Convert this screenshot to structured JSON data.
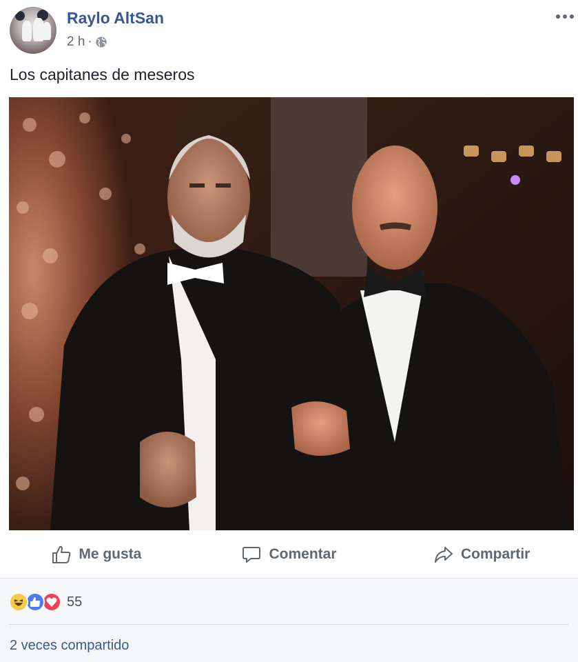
{
  "post": {
    "author": "Raylo AltSan",
    "time": "2 h",
    "separator": "·",
    "privacy_icon": "globe-icon",
    "more_icon": "more-options-icon",
    "text": "Los capitanes de meseros"
  },
  "actions": [
    {
      "label": "Me gusta",
      "icon": "thumbs-up-icon"
    },
    {
      "label": "Comentar",
      "icon": "comment-icon"
    },
    {
      "label": "Compartir",
      "icon": "share-icon"
    }
  ],
  "footer": {
    "reactions": [
      "haha-reaction-icon",
      "like-reaction-icon",
      "love-reaction-icon"
    ],
    "reaction_count": "55",
    "shares": "2 veces compartido"
  },
  "colors": {
    "author_link": "#365899",
    "action_text": "#606770",
    "footer_bg": "#f6f7f9",
    "like_blue": "#4b7bf0",
    "love_red": "#f0405a",
    "haha_yellow": "#f7c94b"
  }
}
